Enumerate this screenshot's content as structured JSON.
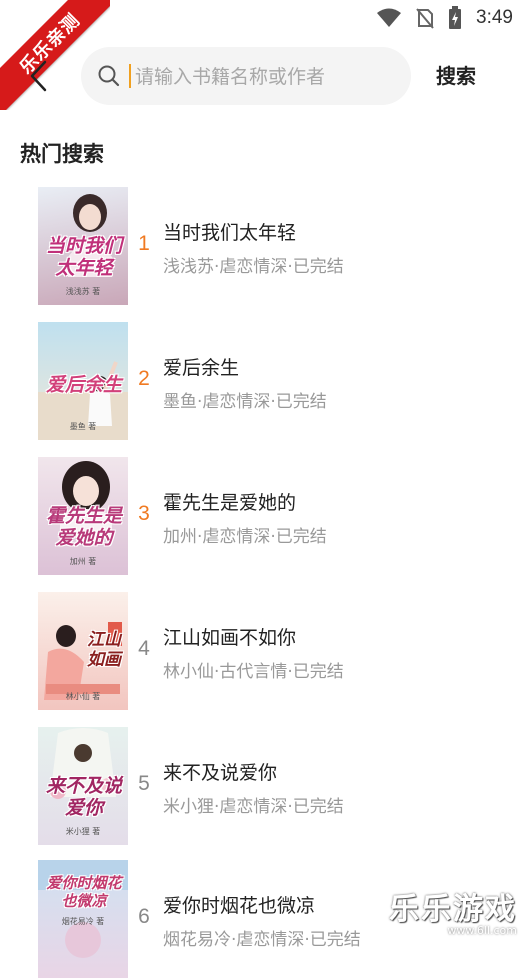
{
  "status_bar": {
    "time": "3:49"
  },
  "ribbon": {
    "text": "乐乐亲测"
  },
  "search": {
    "placeholder": "请输入书籍名称或作者",
    "value": "",
    "button_label": "搜索"
  },
  "section": {
    "title": "热门搜索"
  },
  "books": [
    {
      "rank": "1",
      "title": "当时我们太年轻",
      "meta": "浅浅苏·虐恋情深·已完结",
      "cover_title": "当时我们太年轻",
      "cover_author": "浅浅苏 著",
      "cover_colors": [
        "#e9eef5",
        "#c9a7b8"
      ],
      "title_color": "#c0307a"
    },
    {
      "rank": "2",
      "title": "爱后余生",
      "meta": "墨鱼·虐恋情深·已完结",
      "cover_title": "爱后余生",
      "cover_author": "墨鱼 著",
      "cover_colors": [
        "#bfe0ef",
        "#f0e8d8"
      ],
      "title_color": "#d2407a"
    },
    {
      "rank": "3",
      "title": "霍先生是爱她的",
      "meta": "加州·虐恋情深·已完结",
      "cover_title": "霍先生是爱她的",
      "cover_author": "加州 著",
      "cover_colors": [
        "#f1e6ec",
        "#dcc1d6"
      ],
      "title_color": "#b83a7a"
    },
    {
      "rank": "4",
      "title": "江山如画不如你",
      "meta": "林小仙·古代言情·已完结",
      "cover_title": "江山如画",
      "cover_author": "林小仙 著",
      "cover_colors": [
        "#fbf0ea",
        "#f2c5bf"
      ],
      "title_color": "#8a1f1f"
    },
    {
      "rank": "5",
      "title": "来不及说爱你",
      "meta": "米小狸·虐恋情深·已完结",
      "cover_title": "来不及说爱你",
      "cover_author": "米小狸 著",
      "cover_colors": [
        "#e6f1ee",
        "#e4dde9"
      ],
      "title_color": "#a12662"
    },
    {
      "rank": "6",
      "title": "爱你时烟花也微凉",
      "meta": "烟花易冷·虐恋情深·已完结",
      "cover_title": "爱你时烟花也微凉",
      "cover_author": "烟花易冷 著",
      "cover_colors": [
        "#cfe2f2",
        "#e9d5e6"
      ],
      "title_color": "#c23a6e"
    }
  ],
  "watermark": {
    "text": "乐乐游戏",
    "url": "www.6ll.com"
  }
}
